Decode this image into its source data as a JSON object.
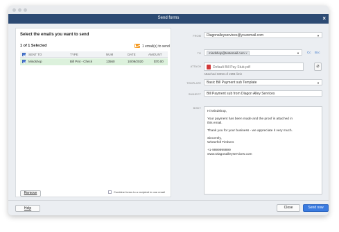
{
  "window": {
    "title": "Send forms"
  },
  "left": {
    "heading": "Select the emails you want to send",
    "selected_count": "1 of 1 Selected",
    "emails_to_send": "1 email(s) to send",
    "columns": [
      "SENT TO",
      "TYPE",
      "NUM",
      "DATE",
      "AMOUNT"
    ],
    "rows": [
      {
        "checked": true,
        "sent_to": "Mindshop",
        "type": "Bill Pmt - Check",
        "num": "13560",
        "date": "10/09/2020",
        "amount": "$70.00"
      }
    ],
    "remove_label": "Remove",
    "combine_label": "Combine forms to a recipient in one email"
  },
  "form": {
    "from_label": "FROM",
    "from_value": "Diagonalleyservices@youremail.com",
    "to_label": "TO",
    "to_value": "mindshop@testemail.com",
    "cc_label": "Cc",
    "bcc_label": "Bcc",
    "attach_label": "ATTACH",
    "attach_file": "Default Bill Pay Stub.pdf",
    "attach_size": "Attached 60KB of 2MB limit",
    "template_label": "TEMPLATE",
    "template_value": "Basic Bill Payment sub Template",
    "subject_label": "SUBJECT",
    "subject_value": "Bill Payment sub from Diagon Alley Services",
    "body_label": "BODY",
    "body_lines": [
      "Hi Mindshop,",
      "Your payment has been made and the proof is attached in",
      "this email.",
      "Thank you for your business - we appreciate it very much.",
      "Sincerely,",
      "Winterfell Timbers",
      "+1-9999999999",
      "www.Diagonalleyservices.com"
    ]
  },
  "footer": {
    "help_label": "Help",
    "close_label": "Close",
    "send_label": "Send now"
  },
  "colors": {
    "titlebar": "#2c4a73",
    "selected_row": "#dcf1dc",
    "accent": "#3a7be0"
  }
}
